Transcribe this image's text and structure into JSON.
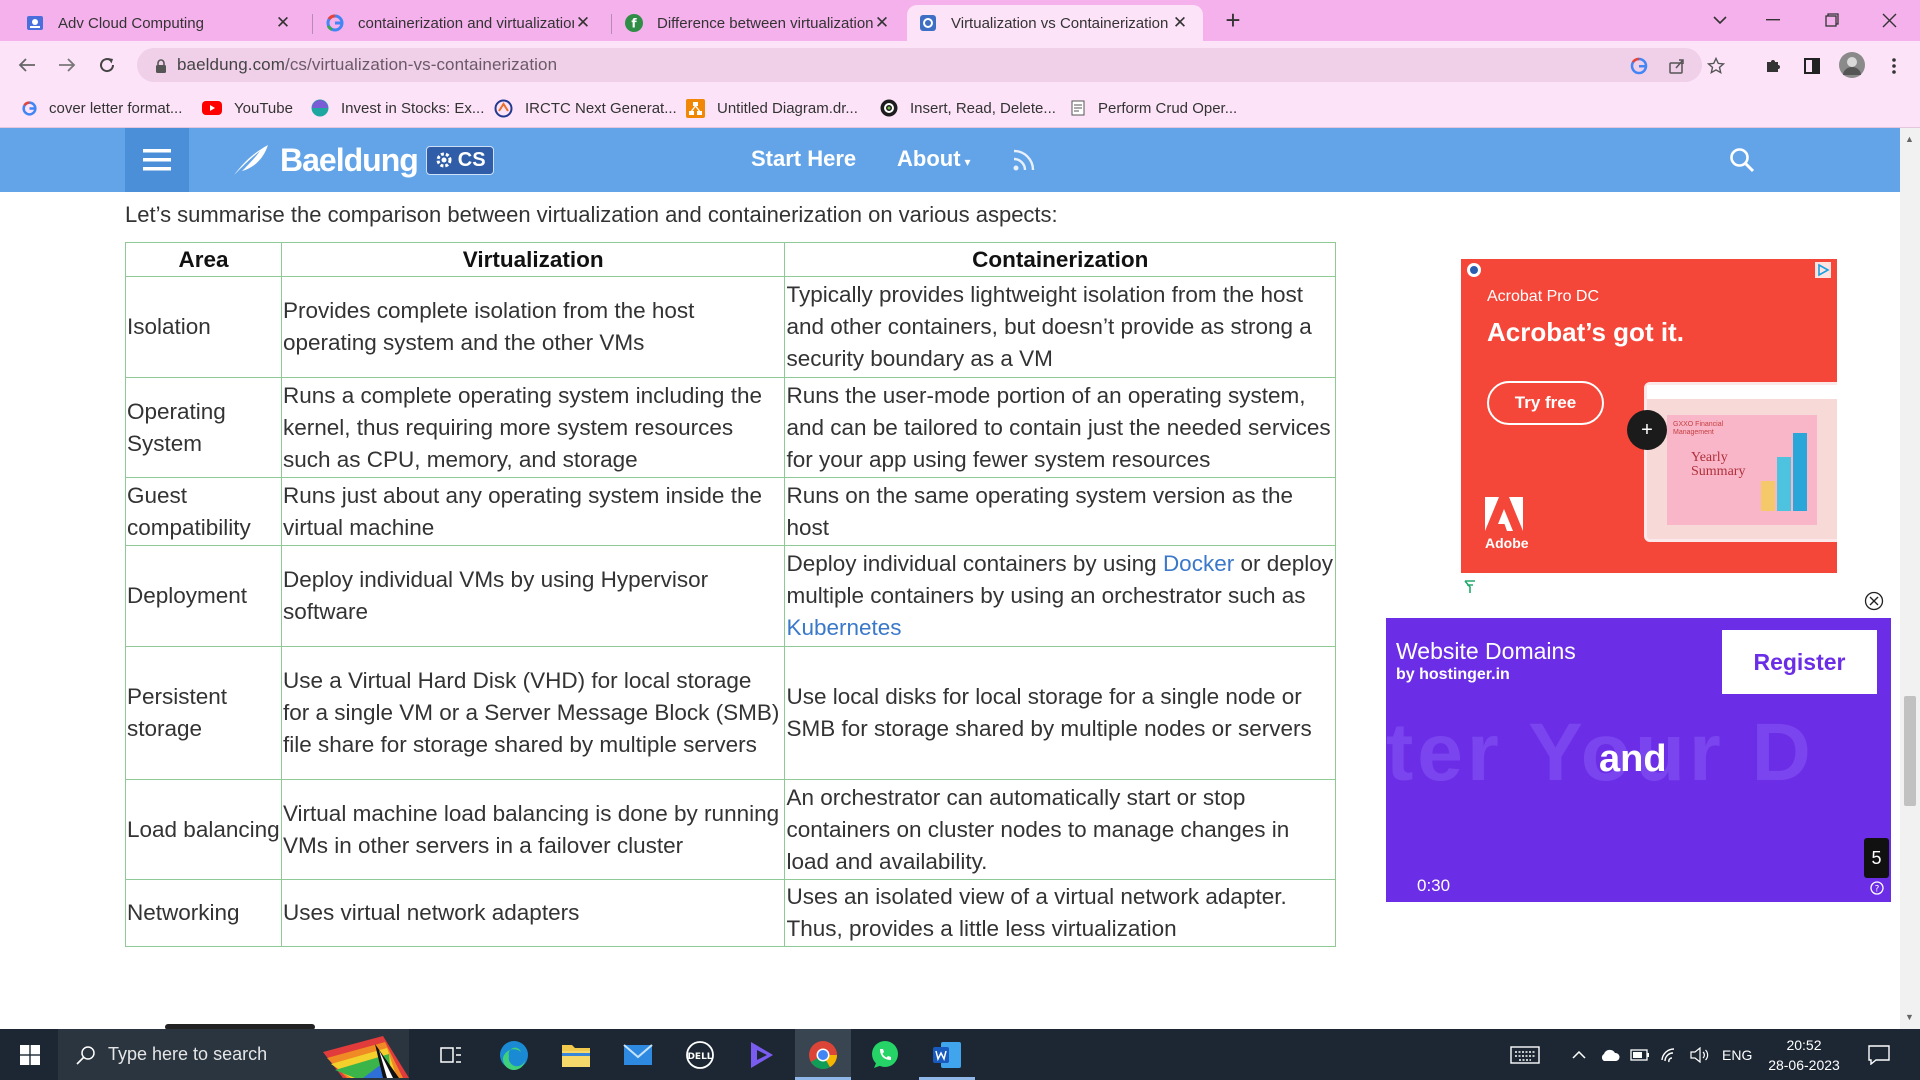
{
  "browser": {
    "tabs": [
      {
        "title": "Adv Cloud Computing",
        "icon": "classroom-icon"
      },
      {
        "title": "containerization and virtualization",
        "icon": "google-icon"
      },
      {
        "title": "Difference between virtualization",
        "icon": "geeksforgeeks-icon"
      },
      {
        "title": "Virtualization vs Containerization",
        "icon": "baeldung-icon"
      }
    ],
    "active_tab": 3,
    "url_host": "baeldung.com",
    "url_path": "/cs/virtualization-vs-containerization",
    "bookmarks": [
      {
        "label": "cover letter format...",
        "icon": "google-icon"
      },
      {
        "label": "YouTube",
        "icon": "youtube-icon"
      },
      {
        "label": "Invest in Stocks: Ex...",
        "icon": "globe-icon"
      },
      {
        "label": "IRCTC Next Generat...",
        "icon": "irctc-icon"
      },
      {
        "label": "Untitled Diagram.dr...",
        "icon": "drawio-icon"
      },
      {
        "label": "Insert, Read, Delete...",
        "icon": "gear-icon"
      },
      {
        "label": "Perform Crud Oper...",
        "icon": "page-icon"
      }
    ],
    "colors": {
      "tab_strip": "#f5b1ec",
      "toolbar": "#fce3f8"
    }
  },
  "site": {
    "logo": "Baeldung",
    "badge": "CS",
    "nav": [
      "Start Here",
      "About"
    ],
    "header_color": "#63a4e8"
  },
  "article": {
    "intro": "Let’s summarise the comparison between virtualization and containerization on various aspects:",
    "table": {
      "headers": [
        "Area",
        "Virtualization",
        "Containerization"
      ],
      "rows": [
        {
          "area": "Isolation",
          "virt": "Provides complete isolation from the host operating system and the other VMs",
          "cont": "Typically provides lightweight isolation from the host and other containers, but doesn’t provide as strong a security boundary as a VM"
        },
        {
          "area": "Operating System",
          "virt": "Runs a complete operating system including the kernel, thus requiring more system resources such as CPU, memory, and storage",
          "cont": "Runs the user-mode portion of an operating system, and can be tailored to contain just the needed services for your app using fewer system resources"
        },
        {
          "area": "Guest compatibility",
          "virt": "Runs just about any operating system inside the virtual machine",
          "cont": "Runs on the same operating system version as the host"
        },
        {
          "area": "Deployment",
          "virt": "Deploy individual VMs by using Hypervisor software",
          "cont_pre": "Deploy individual containers by using ",
          "cont_link1": "Docker",
          "cont_mid": " or deploy multiple containers by using an orchestrator such as ",
          "cont_link2": "Kubernetes"
        },
        {
          "area": "Persistent storage",
          "virt": "Use a Virtual Hard Disk (VHD) for local storage for a single VM or a Server Message Block (SMB) file share for storage shared by multiple servers",
          "cont": "Use local disks for local storage for a single node or SMB for storage shared by multiple nodes or servers"
        },
        {
          "area": "Load balancing",
          "virt": "Virtual machine load balancing is done by running VMs in other servers in a failover cluster",
          "cont": "An orchestrator can automatically start or stop containers on cluster nodes to manage changes in load and availability."
        },
        {
          "area": "Networking",
          "virt": "Uses virtual network adapters",
          "cont": "Uses an isolated view of a virtual network adapter. Thus, provides a little less virtualization"
        }
      ]
    },
    "link_color": "#3a78c9",
    "border_color": "#8fca96"
  },
  "ads": {
    "acrobat": {
      "product": "Acrobat Pro DC",
      "headline": "Acrobat’s got it.",
      "cta": "Try free",
      "brand": "Adobe",
      "card_title": "Yearly Summary",
      "card_logo": "GXXO Financial Management",
      "color": "#f4473a"
    },
    "hostinger": {
      "title": "Website Domains",
      "subtitle": "by hostinger.in",
      "cta": "Register",
      "big_word": "and",
      "bg_text": "ter Your D",
      "time": "0:30",
      "countdown": "5",
      "color": "#6b2ee6"
    }
  },
  "taskbar": {
    "search_placeholder": "Type here to search",
    "lang": "ENG",
    "time": "20:52",
    "date": "28-06-2023",
    "apps": [
      "task-view-icon",
      "edge-icon",
      "file-explorer-icon",
      "mail-icon",
      "dell-icon",
      "media-icon",
      "chrome-icon",
      "whatsapp-icon",
      "word-icon"
    ]
  }
}
